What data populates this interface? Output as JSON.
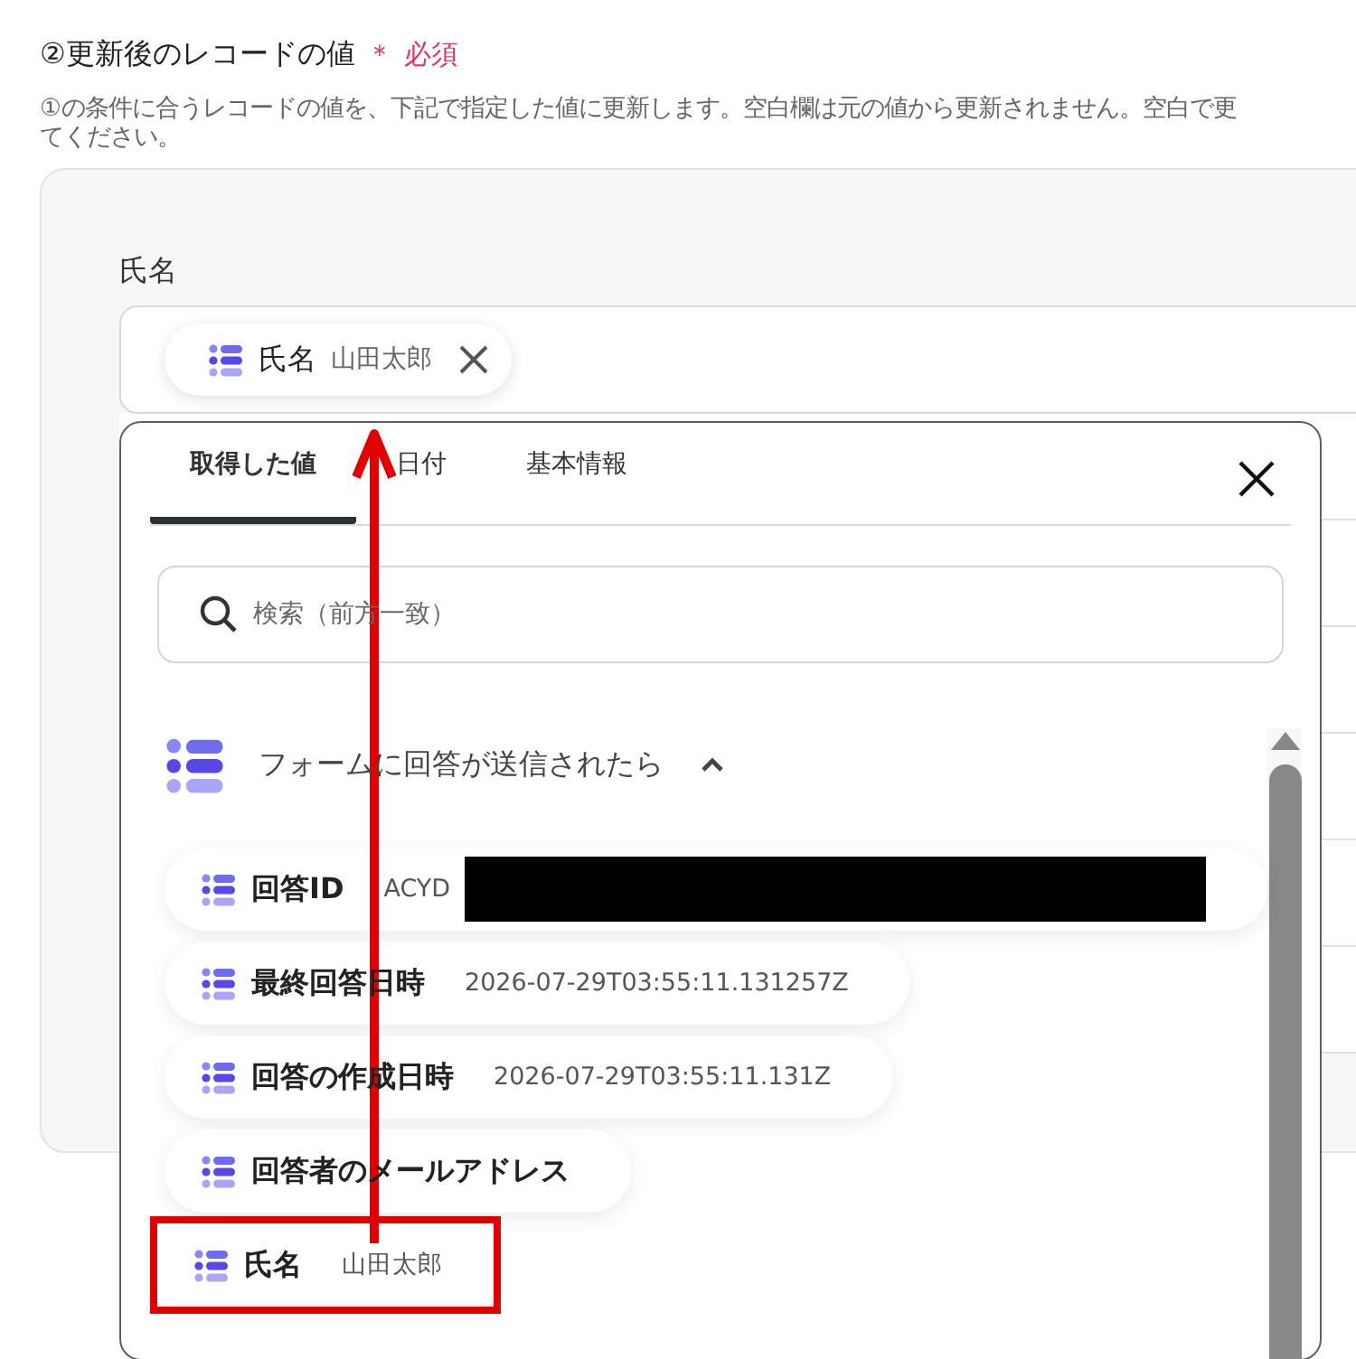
{
  "section": {
    "title": "②更新後のレコードの値",
    "required_mark": "＊",
    "required_label": "必須",
    "description_lines": [
      "①の条件に合うレコードの値を、下記で指定した値に更新します。空白欄は元の値から更新されません。空白で更",
      "てください。"
    ]
  },
  "field": {
    "label": "氏名",
    "chip": {
      "name": "氏名",
      "value": "山田太郎"
    }
  },
  "popup": {
    "tabs": [
      {
        "label": "取得した値",
        "selected": true
      },
      {
        "label": "日付",
        "selected": false
      },
      {
        "label": "基本情報",
        "selected": false
      }
    ],
    "search": {
      "placeholder": "検索（前方一致）"
    },
    "group": {
      "title": "フォームに回答が送信されたら",
      "expanded": true
    },
    "items": [
      {
        "name": "回答ID",
        "value": "ACYD",
        "redacted": true,
        "highlighted": false
      },
      {
        "name": "最終回答日時",
        "value": "2026-07-29T03:55:11.131257Z",
        "redacted": false,
        "highlighted": false
      },
      {
        "name": "回答の作成日時",
        "value": "2026-07-29T03:55:11.131Z",
        "redacted": false,
        "highlighted": false
      },
      {
        "name": "回答者のメールアドレス",
        "redacted": false,
        "highlighted": false
      },
      {
        "name": "氏名",
        "value": "山田太郎",
        "redacted": false,
        "highlighted": true
      }
    ]
  }
}
